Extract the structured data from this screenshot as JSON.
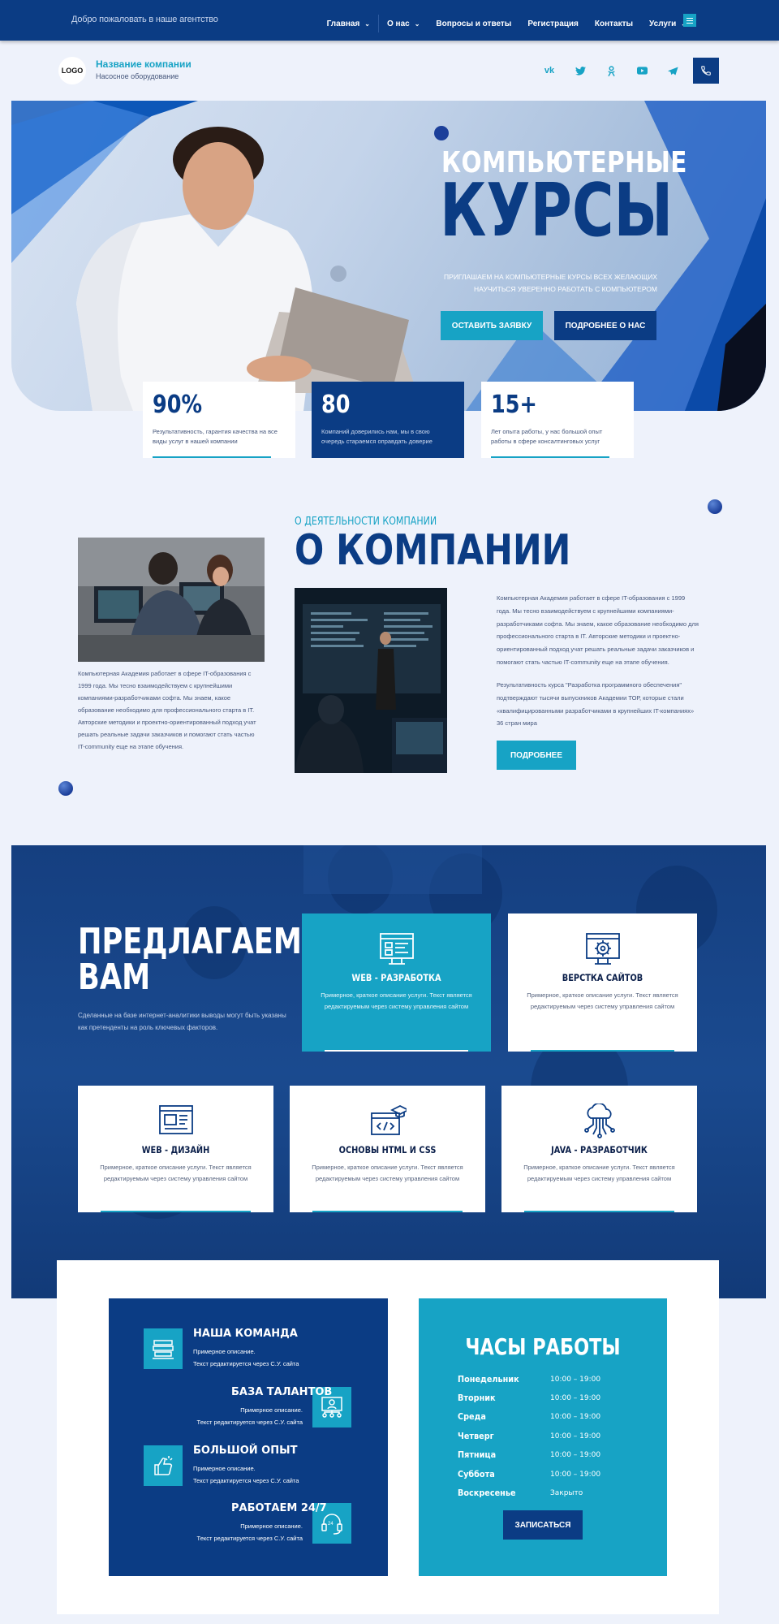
{
  "topbar": {
    "welcome": "Добро пожаловать в наше агентство",
    "nav": [
      {
        "label": "Главная",
        "chevron": true
      },
      {
        "label": "О нас",
        "chevron": true
      },
      {
        "label": "Вопросы и ответы",
        "chevron": false
      },
      {
        "label": "Регистрация",
        "chevron": false
      },
      {
        "label": "Контакты",
        "chevron": false
      },
      {
        "label": "Услуги",
        "chevron": true
      }
    ]
  },
  "header": {
    "logo": "LOGO",
    "company_name": "Название компании",
    "company_sub": "Насосное оборудование",
    "socials": [
      "vk-icon",
      "twitter-icon",
      "odnoklassniki-icon",
      "youtube-icon",
      "telegram-icon"
    ]
  },
  "hero": {
    "title_line1": "КОМПЬЮТЕРНЫЕ",
    "title_line2": "КУРСЫ",
    "subtitle_line1": "ПРИГЛАШАЕМ НА КОМПЬЮТЕРНЫЕ КУРСЫ ВСЕХ ЖЕЛАЮЩИХ",
    "subtitle_line2": "НАУЧИТЬСЯ УВЕРЕННО РАБОТАТЬ С КОМПЬЮТЕРОМ",
    "btn_apply": "ОСТАВИТЬ ЗАЯВКУ",
    "btn_more": "ПОДРОБНЕЕ О НАС"
  },
  "stats": [
    {
      "value": "90%",
      "desc": "Результативность, гарантия качества на все виды услуг в нашей компании"
    },
    {
      "value": "80",
      "desc": "Компаний доверились нам, мы в свою очередь стараемся оправдать доверие"
    },
    {
      "value": "15+",
      "desc": "Лет опыта работы, у нас большой опыт работы в сфере консалтинговых услуг"
    }
  ],
  "about": {
    "kicker": "О ДЕЯТЕЛЬНОСТИ КОМПАНИИ",
    "title": "О КОМПАНИИ",
    "text_left": "Компьютерная Академия работает в сфере IT-образования с 1999 года. Мы тесно взаимодействуем с крупнейшими компаниями-разработчиками софта. Мы знаем, какое образование необходимо для профессионального старта в IT. Авторские методики и проектно-ориентированный подход учат решать реальные задачи заказчиков и помогают стать частью IT-community еще на этапе обучения.",
    "text_right1": "Компьютерная Академия работает в сфере IT-образования с 1999 года. Мы тесно взаимодействуем с крупнейшими компаниями-разработчиками софта. Мы знаем, какое образование необходимо для профессионального старта в IT. Авторские методики и проектно-ориентированный подход учат решать реальные задачи заказчиков и помогают стать частью IT-community еще на этапе обучения.",
    "text_right2": "Результативность курса \"Разработка программного обеспечения\" подтверждают тысячи выпускников Академии ТОР, которые стали «квалифицированными разработчиками в крупнейших IT-компаниях» 36 стран мира",
    "btn_more": "ПОДРОБНЕЕ"
  },
  "services": {
    "title_line1": "ПРЕДЛАГАЕМ",
    "title_line2": "ВАМ",
    "subtitle": "Сделанные на базе интернет-аналитики выводы могут быть указаны как претенденты на роль ключевых факторов.",
    "items": [
      {
        "name": "WEB - РАЗРАБОТКА",
        "desc": "Примерное, краткое описание услуги. Текст является редактируемым через систему управления сайтом",
        "icon": "web-development-icon"
      },
      {
        "name": "ВЕРСТКА САЙТОВ",
        "desc": "Примерное, краткое описание услуги. Текст является редактируемым через систему управления сайтом",
        "icon": "site-layout-icon"
      },
      {
        "name": "WEB - ДИЗАЙН",
        "desc": "Примерное, краткое описание услуги. Текст является редактируемым через систему управления сайтом",
        "icon": "web-design-icon"
      },
      {
        "name": "ОСНОВЫ HTML И CSS",
        "desc": "Примерное, краткое описание услуги. Текст является редактируемым через систему управления сайтом",
        "icon": "html-css-icon"
      },
      {
        "name": "JAVA - РАЗРАБОТЧИК",
        "desc": "Примерное, краткое описание услуги. Текст является редактируемым через систему управления сайтом",
        "icon": "java-developer-icon"
      }
    ]
  },
  "features": [
    {
      "title": "НАША КОМАНДА",
      "line1": "Примерное описание.",
      "line2": "Текст редактируется через С.У. сайта",
      "icon": "books-icon"
    },
    {
      "title": "БАЗА ТАЛАНТОВ",
      "line1": "Примерное описание.",
      "line2": "Текст редактируется через С.У. сайта",
      "icon": "talent-icon"
    },
    {
      "title": "БОЛЬШОЙ ОПЫТ",
      "line1": "Примерное описание.",
      "line2": "Текст редактируется через С.У. сайта",
      "icon": "thumbs-up-icon"
    },
    {
      "title": "РАБОТАЕМ 24/7",
      "line1": "Примерное описание.",
      "line2": "Текст редактируется через С.У. сайта",
      "icon": "headset-24-icon"
    }
  ],
  "hours": {
    "title": "ЧАСЫ РАБОТЫ",
    "rows": [
      {
        "day": "Понедельник",
        "time": "10:00 – 19:00"
      },
      {
        "day": "Вторник",
        "time": "10:00 – 19:00"
      },
      {
        "day": "Среда",
        "time": "10:00 – 19:00"
      },
      {
        "day": "Четверг",
        "time": "10:00 – 19:00"
      },
      {
        "day": "Пятница",
        "time": "10:00 – 19:00"
      },
      {
        "day": "Суббота",
        "time": "10:00 – 19:00"
      },
      {
        "day": "Воскресенье",
        "time": "Закрыто"
      }
    ],
    "btn_signup": "ЗАПИСАТЬСЯ"
  }
}
